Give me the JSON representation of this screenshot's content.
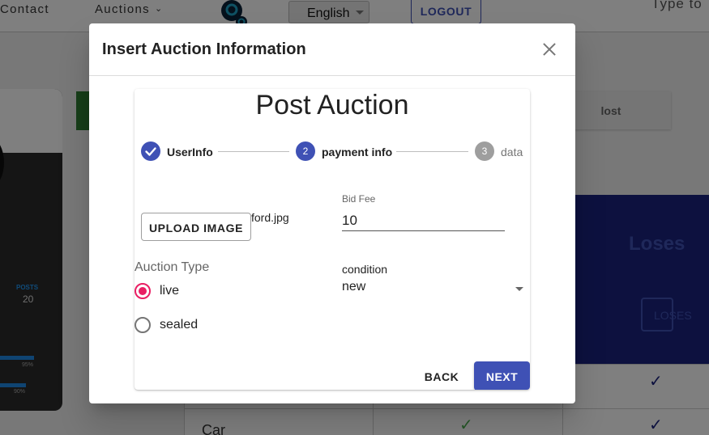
{
  "nav": {
    "contact": "Contact",
    "auctions": "Auctions",
    "language": "English",
    "logout": "LOGOUT",
    "search_hint": "Type to"
  },
  "profile": {
    "posts_label": "POSTS",
    "posts_value": "20",
    "bars": [
      {
        "percent": "95%",
        "value": 0.95
      },
      {
        "percent": "90%",
        "value": 0.9
      }
    ]
  },
  "background": {
    "lost_tab": "lost",
    "loses_title": "Loses",
    "loses_button": "LOSES",
    "table_row_label": "Car"
  },
  "dialog": {
    "title": "Insert Auction Information",
    "heading": "Post Auction",
    "steps": [
      {
        "number": "1",
        "label": "UserInfo",
        "state": "completed"
      },
      {
        "number": "2",
        "label": "payment info",
        "state": "active"
      },
      {
        "number": "3",
        "label": "data",
        "state": "inactive"
      }
    ],
    "upload_button": "UPLOAD IMAGE",
    "file_name": "ford.jpg",
    "bid_fee": {
      "label": "Bid Fee",
      "value": "10"
    },
    "auction_type": {
      "label": "Auction Type",
      "options": [
        {
          "label": "live",
          "selected": true
        },
        {
          "label": "sealed",
          "selected": false
        }
      ]
    },
    "condition": {
      "label": "condition",
      "value": "new"
    },
    "back_button": "BACK",
    "next_button": "NEXT"
  },
  "colors": {
    "primary": "#3f51b5",
    "radio_selected": "#e91e63",
    "navy_panel": "#1a237e",
    "check_green": "#4caf50"
  },
  "icons": {
    "close": "close-icon",
    "step_complete": "check-icon",
    "dropdown": "chevron-down-icon"
  }
}
